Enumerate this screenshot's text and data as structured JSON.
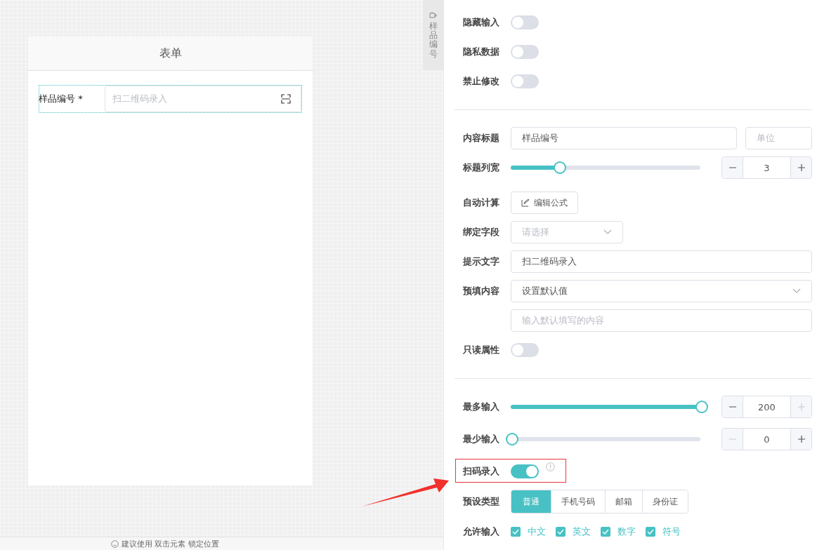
{
  "side_tab": {
    "label": "样品编号"
  },
  "form": {
    "title": "表单",
    "fields": [
      {
        "label": "样品编号",
        "required_mark": "*",
        "placeholder": "扫二维码录入"
      }
    ]
  },
  "hint": "建议使用 双击元素 锁定位置",
  "settings": [
    {
      "kind": "switch",
      "label": "隐藏输入",
      "on": false
    },
    {
      "kind": "switch",
      "label": "隐私数据",
      "on": false
    },
    {
      "kind": "switch",
      "label": "禁止修改",
      "on": false
    },
    {
      "kind": "divider"
    },
    {
      "kind": "title",
      "label": "内容标题",
      "value": "样品编号",
      "unit_placeholder": "单位"
    },
    {
      "kind": "slider",
      "label": "标题列宽",
      "level": 0.25,
      "value": "3",
      "minus_disabled": false,
      "plus_disabled": false
    },
    {
      "kind": "button",
      "label": "自动计算",
      "button": "编辑公式"
    },
    {
      "kind": "select",
      "label": "绑定字段",
      "placeholder": "请选择"
    },
    {
      "kind": "input",
      "label": "提示文字",
      "value": "扫二维码录入"
    },
    {
      "kind": "select_wide",
      "label": "预填内容",
      "value": "设置默认值"
    },
    {
      "kind": "input",
      "placeholder": "输入默认填写的内容"
    },
    {
      "kind": "switch",
      "label": "只读属性",
      "on": false
    },
    {
      "kind": "divider"
    },
    {
      "kind": "slider",
      "label": "最多输入",
      "level": 1,
      "value": "200",
      "minus_disabled": false,
      "plus_disabled": true
    },
    {
      "kind": "slider",
      "label": "最少输入",
      "level": 0,
      "value": "0",
      "minus_disabled": true,
      "plus_disabled": false
    },
    {
      "kind": "switch",
      "label": "扫码录入",
      "on": true,
      "info": true,
      "highlighted": true
    },
    {
      "kind": "segmented",
      "label": "预设类型",
      "options": [
        {
          "label": "普通",
          "selected": true
        },
        {
          "label": "手机号码",
          "selected": false
        },
        {
          "label": "邮箱",
          "selected": false
        },
        {
          "label": "身份证",
          "selected": false
        }
      ]
    },
    {
      "kind": "checkboxes",
      "label": "允许输入",
      "options": [
        {
          "label": "中文",
          "checked": true
        },
        {
          "label": "英文",
          "checked": true
        },
        {
          "label": "数字",
          "checked": true
        },
        {
          "label": "符号",
          "checked": true
        }
      ]
    }
  ]
}
